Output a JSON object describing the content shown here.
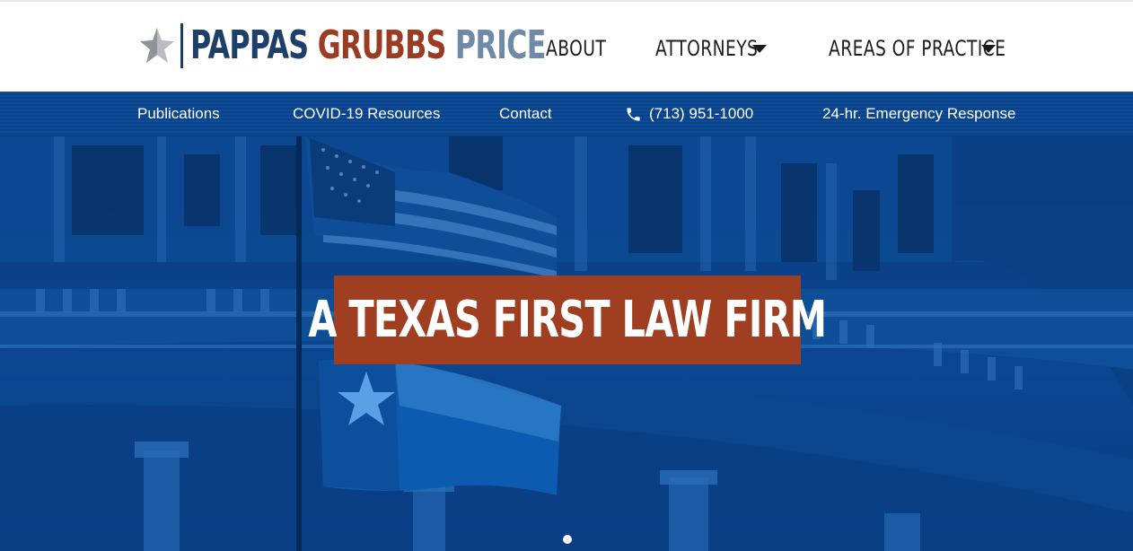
{
  "brand": {
    "word1": "PAPPAS",
    "word2": "GRUBBS",
    "word3": "PRICE",
    "icon": "star-icon",
    "colors": {
      "word1": "#1f3f6b",
      "word2": "#9b3b22",
      "word3": "#6f8aa6"
    }
  },
  "main_nav": [
    {
      "label": "ABOUT",
      "has_dropdown": false
    },
    {
      "label": "ATTORNEYS",
      "has_dropdown": true,
      "icon": "caret-down-icon"
    },
    {
      "label": "AREAS OF PRACTICE",
      "has_dropdown": true,
      "icon": "caret-down-icon"
    }
  ],
  "utility_nav": {
    "publications": "Publications",
    "covid": "COVID-19 Resources",
    "contact": "Contact",
    "phone": "(713) 951-1000",
    "phone_icon": "phone-icon",
    "emergency": "24-hr. Emergency Response"
  },
  "hero": {
    "headline": "A TEXAS FIRST LAW FIRM",
    "banner_color": "#a03e22",
    "slide_count": 1,
    "active_slide": 1
  },
  "colors": {
    "utility_bar": "#0d4c96",
    "hero_tint": "#0b4690"
  }
}
